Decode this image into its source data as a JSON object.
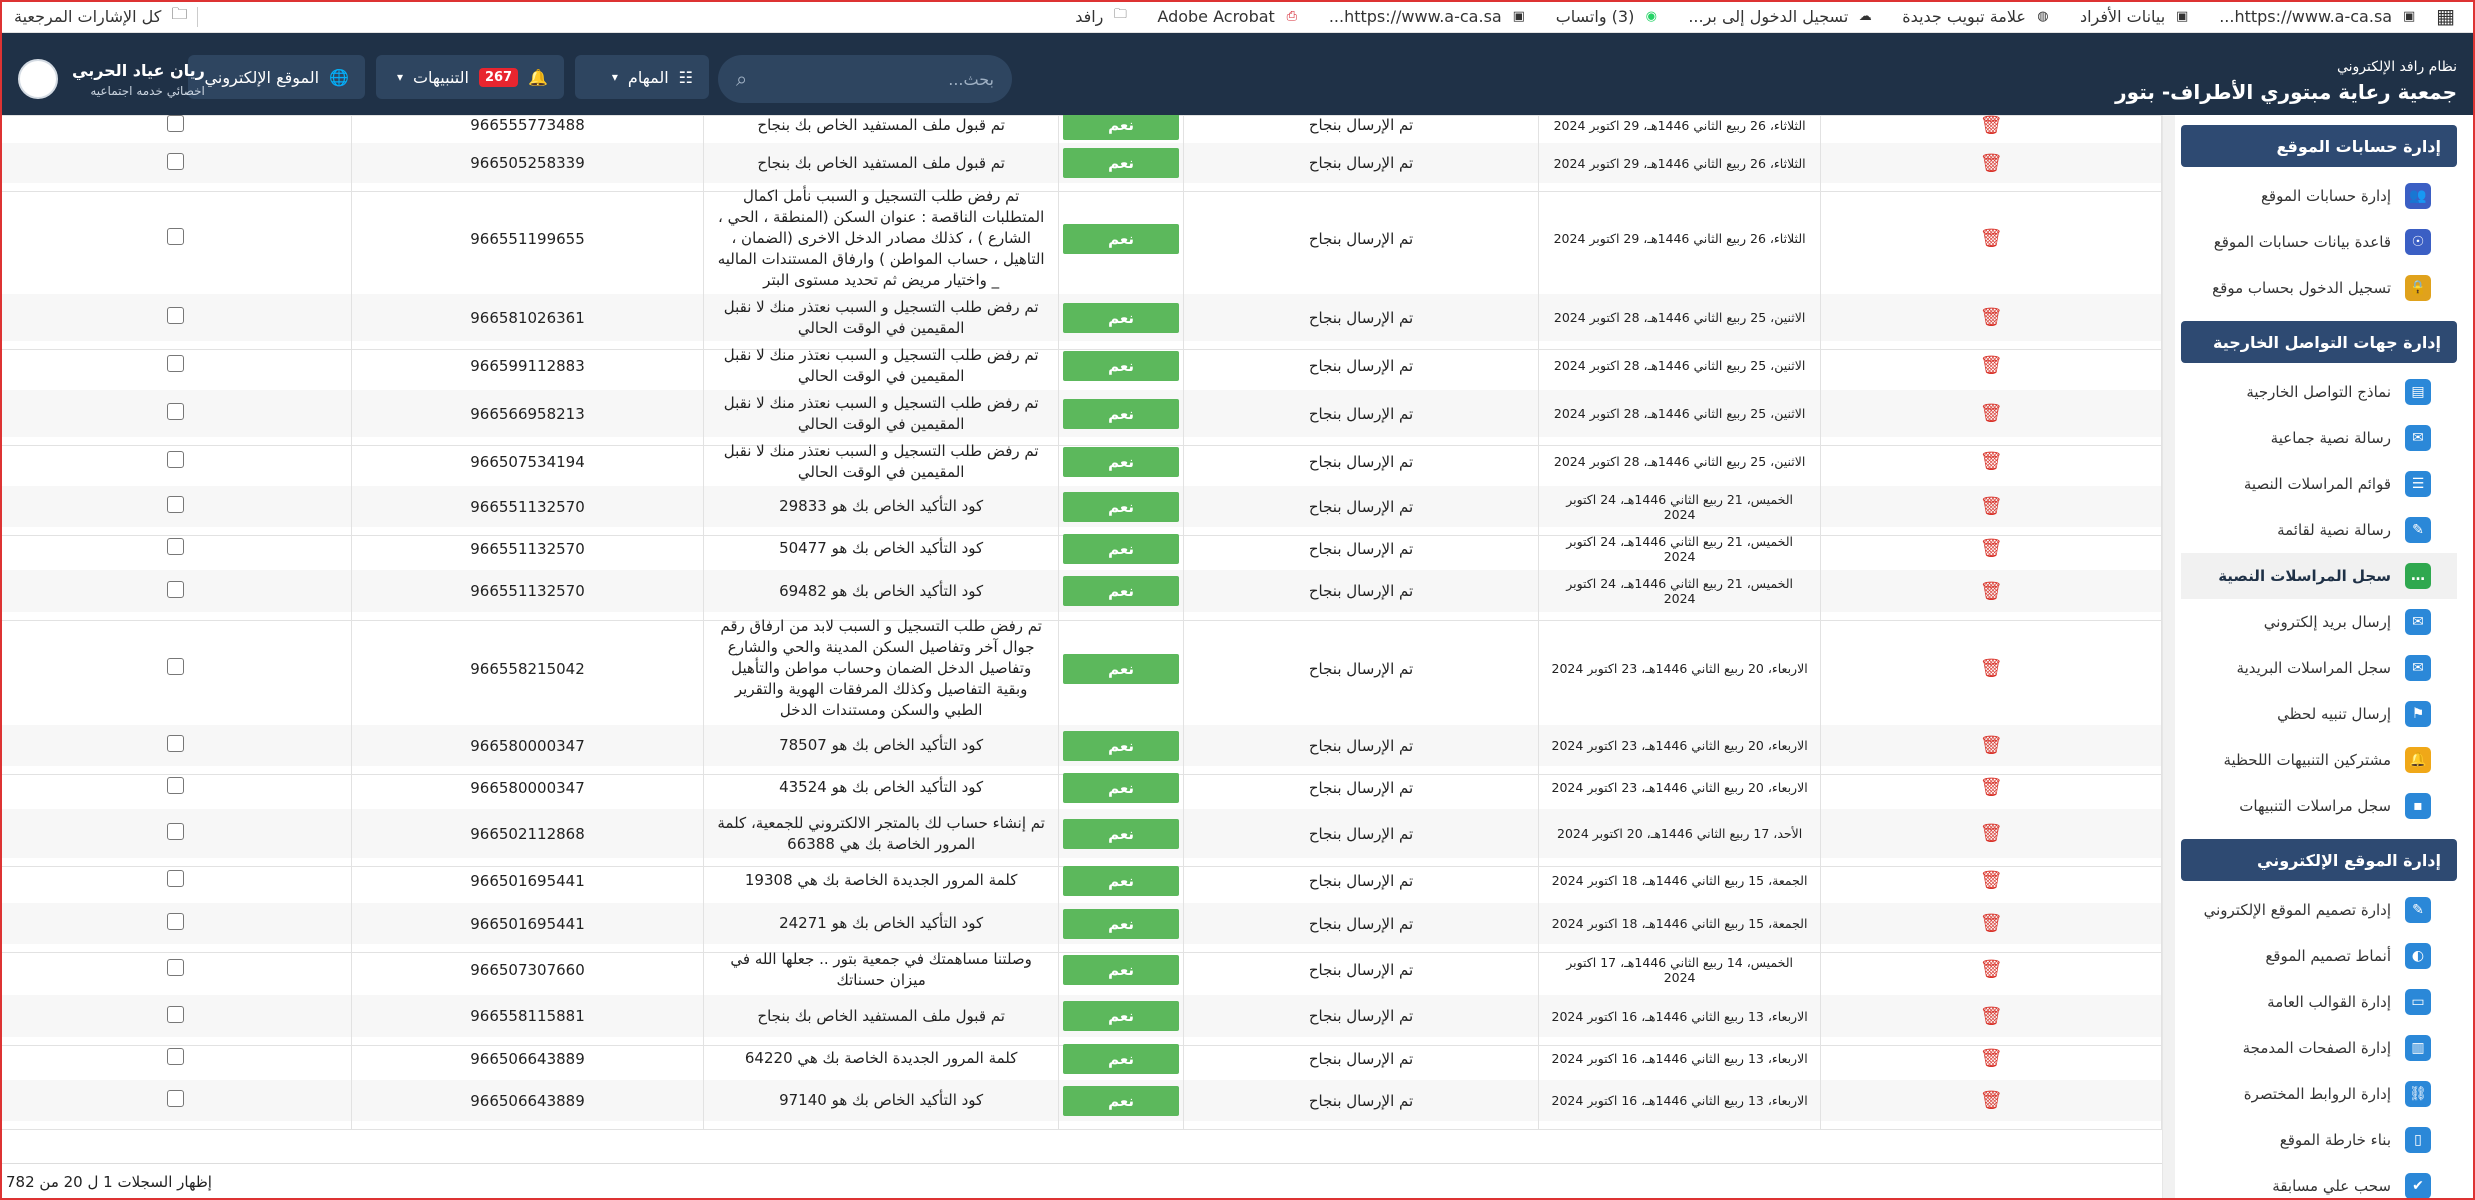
{
  "bookmarks": {
    "items": [
      {
        "label": "https://www.a-ca.sa...",
        "icon": "page-icon"
      },
      {
        "label": "بيانات الأفراد",
        "icon": "page-icon"
      },
      {
        "label": "علامة تبويب جديدة",
        "icon": "globe-icon"
      },
      {
        "label": "تسجيل الدخول إلى بر...",
        "icon": "cloud-icon"
      },
      {
        "label": "(3) واتساب",
        "icon": "whatsapp-icon"
      },
      {
        "label": "https://www.a-ca.sa...",
        "icon": "page-icon"
      },
      {
        "label": "Adobe Acrobat",
        "icon": "pdf-icon"
      },
      {
        "label": "رافد",
        "icon": "folder-icon"
      }
    ],
    "all_label": "كل الإشارات المرجعية"
  },
  "header": {
    "site_sub": "نظام رافد الإلكتروني",
    "site_title": "جمعية رعاية مبتوري الأطراف- بتور",
    "search_placeholder": "بحث...",
    "tasks_label": "المهام",
    "notifications_label": "التنبيهات",
    "notifications_count": "267",
    "website_label": "الموقع الإلكتروني",
    "user_name": "ريان عياد الحربي",
    "user_role": "اخصائي خدمه اجتماعيه"
  },
  "sidebar": {
    "sections": [
      {
        "title": "إدارة حسابات الموقع",
        "items": [
          {
            "label": "إدارة حسابات الموقع",
            "icon": "users-icon",
            "color": "#3b5fc4"
          },
          {
            "label": "قاعدة بيانات حسابات الموقع",
            "icon": "user-db-icon",
            "color": "#3b5fc4"
          },
          {
            "label": "تسجيل الدخول بحساب موقع",
            "icon": "lock-user-icon",
            "color": "#e0a21c"
          }
        ]
      },
      {
        "title": "إدارة جهات التواصل الخارجية",
        "items": [
          {
            "label": "نماذج التواصل الخارجية",
            "icon": "forms-icon",
            "color": "#2b88d8"
          },
          {
            "label": "رسالة نصية جماعية",
            "icon": "group-sms-icon",
            "color": "#2b88d8"
          },
          {
            "label": "قوائم المراسلات النصية",
            "icon": "sms-list-icon",
            "color": "#2b88d8"
          },
          {
            "label": "رسالة نصية لقائمة",
            "icon": "list-sms-icon",
            "color": "#2b88d8"
          },
          {
            "label": "سجل المراسلات النصية",
            "icon": "sms-log-icon",
            "color": "#2fa84f",
            "active": true
          },
          {
            "label": "إرسال بريد إلكتروني",
            "icon": "mail-icon",
            "color": "#2b88d8"
          },
          {
            "label": "سجل المراسلات البريدية",
            "icon": "mail-log-icon",
            "color": "#2b88d8"
          },
          {
            "label": "إرسال تنبيه لحظي",
            "icon": "alert-send-icon",
            "color": "#2b88d8"
          },
          {
            "label": "مشتركين التنبيهات اللحظية",
            "icon": "bell-subscribers-icon",
            "color": "#f0a818"
          },
          {
            "label": "سجل مراسلات التنبيهات",
            "icon": "save-log-icon",
            "color": "#2b88d8"
          }
        ]
      },
      {
        "title": "إدارة الموقع الإلكتروني",
        "items": [
          {
            "label": "إدارة تصميم الموقع الإلكتروني",
            "icon": "design-icon",
            "color": "#2b88d8"
          },
          {
            "label": "أنماط تصميم الموقع",
            "icon": "palette-icon",
            "color": "#2b88d8"
          },
          {
            "label": "إدارة القوالب العامة",
            "icon": "template-icon",
            "color": "#2b88d8"
          },
          {
            "label": "إدارة الصفحات المدمجة",
            "icon": "pages-icon",
            "color": "#2b88d8"
          },
          {
            "label": "إدارة الروابط المختصرة",
            "icon": "link-icon",
            "color": "#2b88d8"
          },
          {
            "label": "بناء خارطة الموقع",
            "icon": "sitemap-icon",
            "color": "#2b88d8"
          },
          {
            "label": "سحب علي مسابقة",
            "icon": "draw-icon",
            "color": "#2b88d8"
          }
        ]
      }
    ]
  },
  "table": {
    "yes_label": "نعم",
    "rows": [
      {
        "date": "الثلاثاء، 26 ربيع الثاني 1446هـ، 29 اكتوبر 2024",
        "status": "تم الإرسال بنجاح",
        "message": "تم قبول ملف المستفيد الخاص بك بنجاح",
        "phone": "966555773488"
      },
      {
        "date": "الثلاثاء، 26 ربيع الثاني 1446هـ، 29 اكتوبر 2024",
        "status": "تم الإرسال بنجاح",
        "message": "تم قبول ملف المستفيد الخاص بك بنجاح",
        "phone": "966505258339"
      },
      {
        "date": "الثلاثاء، 26 ربيع الثاني 1446هـ، 29 اكتوبر 2024",
        "status": "تم الإرسال بنجاح",
        "message": "تم رفض طلب التسجيل و السبب نأمل اكمال المتطلبات الناقصة : عنوان السكن (المنطقة ، الحي ، الشارع ) ، كذلك مصادر الدخل الاخرى (الضمان ، التاهيل ، حساب المواطن ) وارفاق المستندات الماليه _ واختيار مريض ثم تحديد مستوى البتر",
        "phone": "966551199655"
      },
      {
        "date": "الاثنين، 25 ربيع الثاني 1446هـ، 28 اكتوبر 2024",
        "status": "تم الإرسال بنجاح",
        "message": "تم رفض طلب التسجيل و السبب نعتذر منك لا نقبل المقيمين في الوقت الحالي",
        "phone": "966581026361"
      },
      {
        "date": "الاثنين، 25 ربيع الثاني 1446هـ، 28 اكتوبر 2024",
        "status": "تم الإرسال بنجاح",
        "message": "تم رفض طلب التسجيل و السبب نعتذر منك لا نقبل المقيمين في الوقت الحالي",
        "phone": "966599112883"
      },
      {
        "date": "الاثنين، 25 ربيع الثاني 1446هـ، 28 اكتوبر 2024",
        "status": "تم الإرسال بنجاح",
        "message": "تم رفض طلب التسجيل و السبب نعتذر منك لا نقبل المقيمين في الوقت الحالي",
        "phone": "966566958213"
      },
      {
        "date": "الاثنين، 25 ربيع الثاني 1446هـ، 28 اكتوبر 2024",
        "status": "تم الإرسال بنجاح",
        "message": "تم رفض طلب التسجيل و السبب نعتذر منك لا نقبل المقيمين في الوقت الحالي",
        "phone": "966507534194"
      },
      {
        "date": "الخميس، 21 ربيع الثاني 1446هـ، 24 اكتوبر 2024",
        "status": "تم الإرسال بنجاح",
        "message": "كود التأكيد الخاص بك هو 29833",
        "phone": "966551132570"
      },
      {
        "date": "الخميس، 21 ربيع الثاني 1446هـ، 24 اكتوبر 2024",
        "status": "تم الإرسال بنجاح",
        "message": "كود التأكيد الخاص بك هو 50477",
        "phone": "966551132570"
      },
      {
        "date": "الخميس، 21 ربيع الثاني 1446هـ، 24 اكتوبر 2024",
        "status": "تم الإرسال بنجاح",
        "message": "كود التأكيد الخاص بك هو 69482",
        "phone": "966551132570"
      },
      {
        "date": "الاربعاء، 20 ربيع الثاني 1446هـ، 23 اكتوبر 2024",
        "status": "تم الإرسال بنجاح",
        "message": "تم رفض طلب التسجيل و السبب لابد من ارفاق رقم جوال آخر وتفاصيل السكن المدينة والحي والشارع وتفاصيل الدخل الضمان وحساب مواطن والتأهيل وبقية التفاصيل وكذلك المرفقات الهوية والتقرير الطبي والسكن ومستندات الدخل",
        "phone": "966558215042"
      },
      {
        "date": "الاربعاء، 20 ربيع الثاني 1446هـ، 23 اكتوبر 2024",
        "status": "تم الإرسال بنجاح",
        "message": "كود التأكيد الخاص بك هو 78507",
        "phone": "966580000347"
      },
      {
        "date": "الاربعاء، 20 ربيع الثاني 1446هـ، 23 اكتوبر 2024",
        "status": "تم الإرسال بنجاح",
        "message": "كود التأكيد الخاص بك هو 43524",
        "phone": "966580000347"
      },
      {
        "date": "الأحد، 17 ربيع الثاني 1446هـ، 20 اكتوبر 2024",
        "status": "تم الإرسال بنجاح",
        "message": "تم إنشاء حساب لك بالمتجر الالكتروني للجمعية، كلمة المرور الخاصة بك هي 66388",
        "phone": "966502112868"
      },
      {
        "date": "الجمعة، 15 ربيع الثاني 1446هـ، 18 اكتوبر 2024",
        "status": "تم الإرسال بنجاح",
        "message": "كلمة المرور الجديدة الخاصة بك هي 19308",
        "phone": "966501695441"
      },
      {
        "date": "الجمعة، 15 ربيع الثاني 1446هـ، 18 اكتوبر 2024",
        "status": "تم الإرسال بنجاح",
        "message": "كود التأكيد الخاص بك هو 24271",
        "phone": "966501695441"
      },
      {
        "date": "الخميس، 14 ربيع الثاني 1446هـ، 17 اكتوبر 2024",
        "status": "تم الإرسال بنجاح",
        "message": "وصلتنا مساهمتك في جمعية بتور .. جعلها الله في ميزان حسناتك",
        "phone": "966507307660"
      },
      {
        "date": "الاربعاء، 13 ربيع الثاني 1446هـ، 16 اكتوبر 2024",
        "status": "تم الإرسال بنجاح",
        "message": "تم قبول ملف المستفيد الخاص بك بنجاح",
        "phone": "966558115881"
      },
      {
        "date": "الاربعاء، 13 ربيع الثاني 1446هـ، 16 اكتوبر 2024",
        "status": "تم الإرسال بنجاح",
        "message": "كلمة المرور الجديدة الخاصة بك هي 64220",
        "phone": "966506643889"
      },
      {
        "date": "الاربعاء، 13 ربيع الثاني 1446هـ، 16 اكتوبر 2024",
        "status": "تم الإرسال بنجاح",
        "message": "كود التأكيد الخاص بك هو 97140",
        "phone": "966506643889"
      }
    ]
  },
  "footer": {
    "records_text": "إظهار السجلات 1 ل 20 من 782"
  }
}
